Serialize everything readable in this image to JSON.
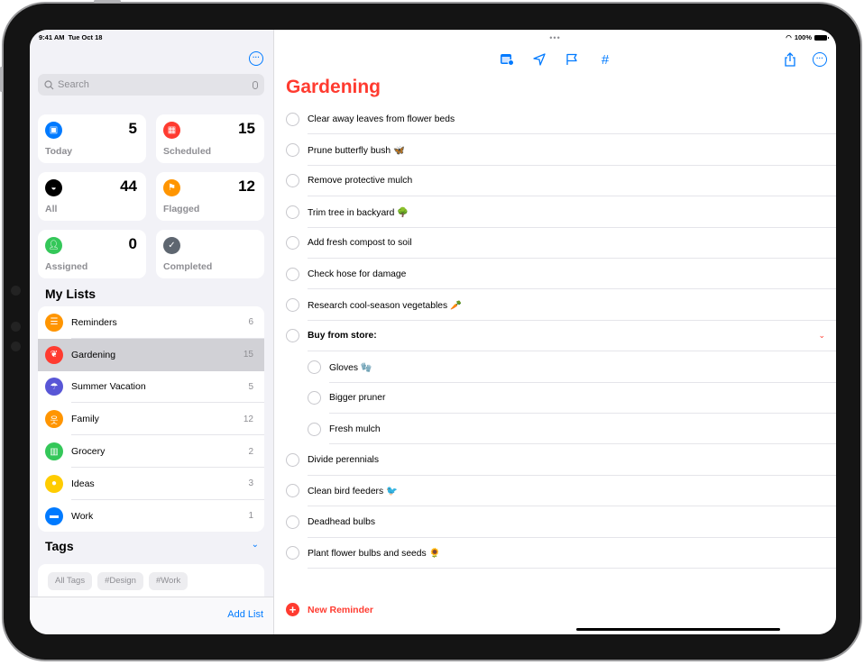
{
  "status_bar": {
    "time": "9:41 AM",
    "date": "Tue Oct 18",
    "battery": "100%",
    "multitask_dots": "•••"
  },
  "sidebar": {
    "more_icon": "ellipsis-circle-icon",
    "search": {
      "placeholder": "Search",
      "value": ""
    },
    "smart_lists": [
      {
        "label": "Today",
        "count": "5",
        "icon": "calendar-icon",
        "color": "#007aff"
      },
      {
        "label": "Scheduled",
        "count": "15",
        "icon": "calendar-grid-icon",
        "color": "#ff3b30"
      },
      {
        "label": "All",
        "count": "44",
        "icon": "tray-icon",
        "color": "#000000"
      },
      {
        "label": "Flagged",
        "count": "12",
        "icon": "flag-icon",
        "color": "#ff9500"
      },
      {
        "label": "Assigned",
        "count": "0",
        "icon": "person-icon",
        "color": "#34c759"
      },
      {
        "label": "Completed",
        "count": "",
        "icon": "checkmark-icon",
        "color": "#5e6670"
      }
    ],
    "my_lists_title": "My Lists",
    "lists": [
      {
        "name": "Reminders",
        "count": "6",
        "icon": "list-bullet-icon",
        "color": "#ff9500",
        "glyph": "☰"
      },
      {
        "name": "Gardening",
        "count": "15",
        "icon": "leaf-icon",
        "color": "#ff3b30",
        "glyph": "❦",
        "selected": true
      },
      {
        "name": "Summer Vacation",
        "count": "5",
        "icon": "umbrella-icon",
        "color": "#5856d6",
        "glyph": "☂"
      },
      {
        "name": "Family",
        "count": "12",
        "icon": "family-icon",
        "color": "#ff9500",
        "glyph": "웃"
      },
      {
        "name": "Grocery",
        "count": "2",
        "icon": "basket-icon",
        "color": "#34c759",
        "glyph": "▥"
      },
      {
        "name": "Ideas",
        "count": "3",
        "icon": "lightbulb-icon",
        "color": "#ffcc00",
        "glyph": "●"
      },
      {
        "name": "Work",
        "count": "1",
        "icon": "briefcase-icon",
        "color": "#007aff",
        "glyph": "▬"
      }
    ],
    "tags_title": "Tags",
    "tags": [
      "All Tags",
      "#Design",
      "#Work"
    ],
    "add_list_label": "Add List"
  },
  "main": {
    "toolbar": {
      "icons": [
        "calendar-date-icon",
        "location-icon",
        "flag-icon",
        "hashtag-icon"
      ],
      "share_icon": "share-icon",
      "more_icon": "ellipsis-circle-icon"
    },
    "title": "Gardening",
    "title_color": "#ff3b30",
    "tasks": [
      {
        "text": "Clear away leaves from flower beds",
        "level": 0
      },
      {
        "text": "Prune butterfly bush 🦋",
        "level": 0
      },
      {
        "text": "Remove protective mulch",
        "level": 0
      },
      {
        "text": "Trim tree in backyard 🌳",
        "level": 0
      },
      {
        "text": "Add fresh compost to soil",
        "level": 0
      },
      {
        "text": "Check hose for damage",
        "level": 0
      },
      {
        "text": "Research cool-season vegetables 🥕",
        "level": 0
      },
      {
        "text": "Buy from store:",
        "level": 0,
        "bold": true,
        "expanded": true
      },
      {
        "text": "Gloves 🧤",
        "level": 1
      },
      {
        "text": "Bigger pruner",
        "level": 1
      },
      {
        "text": "Fresh mulch",
        "level": 1
      },
      {
        "text": "Divide perennials",
        "level": 0
      },
      {
        "text": "Clean bird feeders 🐦",
        "level": 0
      },
      {
        "text": "Deadhead bulbs",
        "level": 0
      },
      {
        "text": "Plant flower bulbs and seeds 🌻",
        "level": 0
      }
    ],
    "new_reminder_label": "New Reminder"
  }
}
